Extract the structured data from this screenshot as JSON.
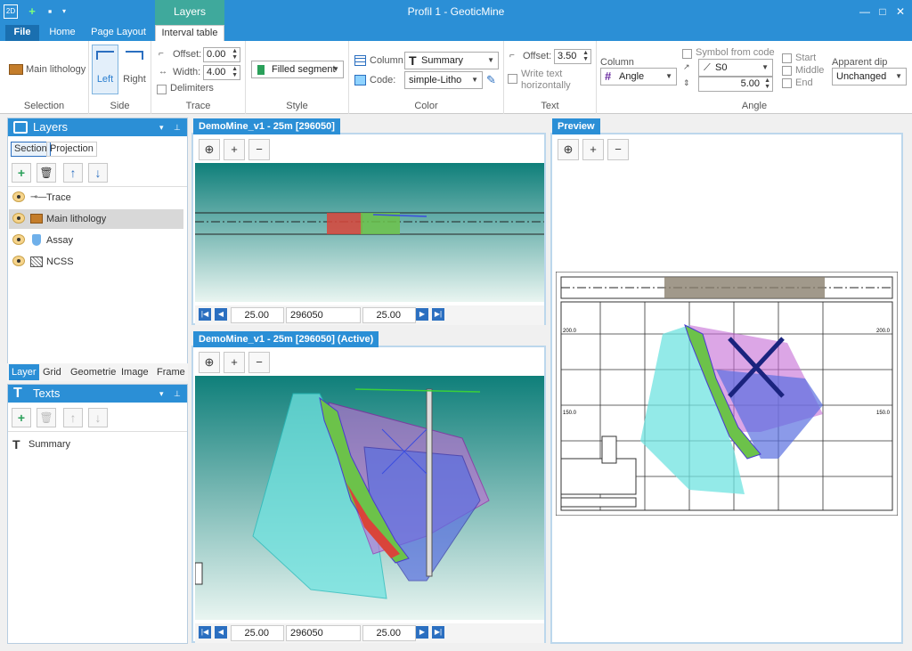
{
  "window": {
    "title": "Profil 1 - GeoticMine",
    "context_tab": "Layers"
  },
  "ribbon_tabs": [
    {
      "label": "File"
    },
    {
      "label": "Home"
    },
    {
      "label": "Page Layout"
    },
    {
      "label": "Interval table"
    }
  ],
  "ribbon": {
    "selection": {
      "item": "Main lithology",
      "group": "Selection"
    },
    "side": {
      "left": "Left",
      "right": "Right",
      "group": "Side"
    },
    "trace": {
      "offset_label": "Offset:",
      "offset_value": "0.00",
      "width_label": "Width:",
      "width_value": "4.00",
      "delimiters": "Delimiters",
      "group": "Trace"
    },
    "style": {
      "value": "Filled segment",
      "group": "Style"
    },
    "color": {
      "column_label": "Column:",
      "column_value": "Summary",
      "code_label": "Code:",
      "code_value": "simple-Litho",
      "group": "Color"
    },
    "text": {
      "offset_label": "Offset:",
      "offset_value": "3.50",
      "write_text": "Write text",
      "write_text2": "horizontally",
      "group": "Text"
    },
    "angle": {
      "column_label": "Column",
      "column_value": "Angle",
      "symbol_from_code": "Symbol from code",
      "symbol_value": "S0",
      "size_value": "5.00",
      "start": "Start",
      "middle": "Middle",
      "end": "End",
      "apparent_dip": "Apparent dip",
      "apparent_value": "Unchanged",
      "group": "Angle"
    }
  },
  "layers_panel": {
    "title": "Layers",
    "subtabs": [
      "Section",
      "Projection"
    ],
    "items": [
      {
        "label": "Trace"
      },
      {
        "label": "Main lithology"
      },
      {
        "label": "Assay"
      },
      {
        "label": "NCSS"
      }
    ],
    "bottom_tabs": [
      "Layer",
      "Grid",
      "Geometrie",
      "Image",
      "Frame"
    ]
  },
  "texts_panel": {
    "title": "Texts",
    "items": [
      {
        "label": "Summary"
      }
    ]
  },
  "views": {
    "top": {
      "title": "DemoMine_v1 - 25m [296050]",
      "nav": {
        "left": "25.00",
        "center": "296050",
        "right": "25.00"
      }
    },
    "bottom": {
      "title": "DemoMine_v1 - 25m [296050] (Active)",
      "nav": {
        "left": "25.00",
        "center": "296050",
        "right": "25.00"
      }
    },
    "preview": {
      "title": "Preview",
      "grid_labels": [
        "200.0",
        "150.0",
        "200.0",
        "150.0"
      ]
    }
  },
  "colors": {
    "accent": "#2b8fd6",
    "context_tab": "#3fa99c",
    "magenta": "#c56bd6",
    "cyan": "#6fe3e0",
    "blue": "#5a6fe0",
    "litho_green": "#6cc24a",
    "litho_red": "#d9443a"
  }
}
